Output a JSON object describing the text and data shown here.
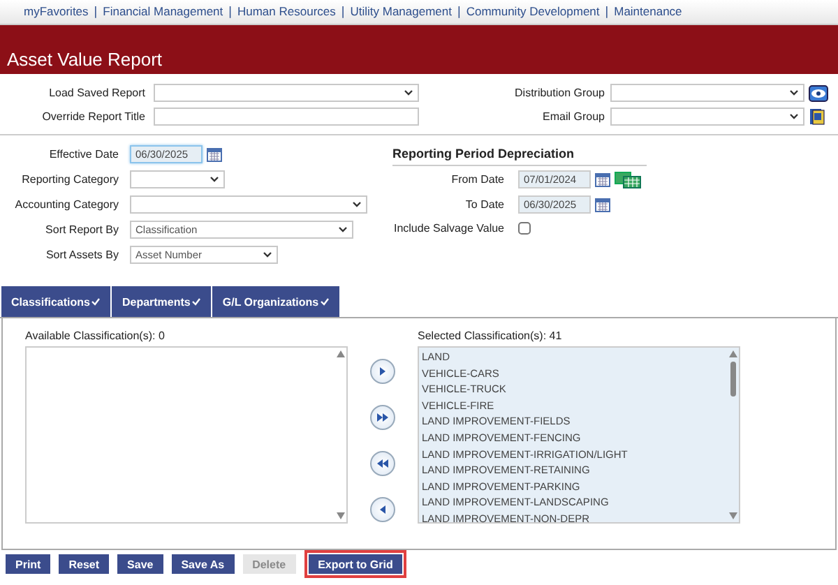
{
  "nav": [
    "myFavorites",
    "Financial Management",
    "Human Resources",
    "Utility Management",
    "Community Development",
    "Maintenance"
  ],
  "nav_separator": "|",
  "title": "Asset Value Report",
  "report_fields": {
    "left": [
      {
        "label": "Load Saved Report",
        "kind": "select"
      },
      {
        "label": "Override Report Title",
        "kind": "text"
      }
    ],
    "right": [
      {
        "label": "Distribution Group",
        "kind": "select"
      },
      {
        "label": "Email Group",
        "kind": "select"
      }
    ]
  },
  "options": {
    "left": [
      {
        "label": "Effective Date",
        "kind": "date",
        "value": "06/30/2025",
        "focused": true
      },
      {
        "label": "Reporting Category",
        "kind": "select"
      },
      {
        "label": "Accounting Category",
        "kind": "select"
      },
      {
        "label": "Sort Report By",
        "kind": "select",
        "value": "Classification"
      },
      {
        "label": "Sort Assets By",
        "kind": "select",
        "value": "Asset Number"
      }
    ],
    "section_title": "Reporting Period Depreciation",
    "right": [
      {
        "label": "From Date",
        "kind": "date",
        "value": "07/01/2024",
        "focused": false
      },
      {
        "label": "To Date",
        "kind": "date",
        "value": "06/30/2025",
        "focused": false
      },
      {
        "label": "Include Salvage Value",
        "kind": "checkbox",
        "checked": false
      }
    ]
  },
  "tabs": [
    "Classifications",
    "Departments",
    "G/L Organizations"
  ],
  "available": {
    "label": "Available Classification(s): 0"
  },
  "selected": {
    "label": "Selected Classification(s): 41",
    "items": [
      "LAND",
      "VEHICLE-CARS",
      "VEHICLE-TRUCK",
      "VEHICLE-FIRE",
      "LAND IMPROVEMENT-FIELDS",
      "LAND IMPROVEMENT-FENCING",
      "LAND IMPROVEMENT-IRRIGATION/LIGHT",
      "LAND IMPROVEMENT-RETAINING",
      "LAND IMPROVEMENT-PARKING",
      "LAND IMPROVEMENT-LANDSCAPING",
      "LAND IMPROVEMENT-NON-DEPR"
    ]
  },
  "buttons": [
    {
      "label": "Print",
      "disabled": false,
      "highlighted": false
    },
    {
      "label": "Reset",
      "disabled": false,
      "highlighted": false
    },
    {
      "label": "Save",
      "disabled": false,
      "highlighted": false
    },
    {
      "label": "Save As",
      "disabled": false,
      "highlighted": false
    },
    {
      "label": "Delete",
      "disabled": true,
      "highlighted": false
    },
    {
      "label": "Export to Grid",
      "disabled": false,
      "highlighted": true
    }
  ]
}
